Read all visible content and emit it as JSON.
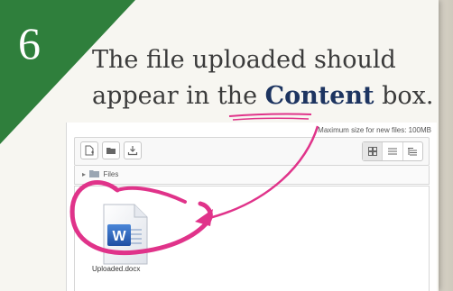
{
  "step": {
    "number": "6"
  },
  "instruction": {
    "line1": "The file uploaded should",
    "line2_before": "appear in the ",
    "keyword": "Content",
    "line2_after": " box."
  },
  "file_manager": {
    "max_size_text": "Maximum size for new files: 100MB",
    "toolbar": {
      "add_icon": "add-file-icon",
      "folder_icon": "create-folder-icon",
      "download_icon": "download-icon",
      "view_icons": [
        "grid-view-icon",
        "list-view-icon",
        "tree-view-icon"
      ]
    },
    "path": {
      "folder_label": "Files"
    },
    "files": [
      {
        "name": "Uploaded.docx",
        "icon": "word-document-icon"
      }
    ]
  },
  "colors": {
    "step_green": "#2f7f3c",
    "highlight_magenta": "#e0338a",
    "keyword_navy": "#1d3460"
  }
}
